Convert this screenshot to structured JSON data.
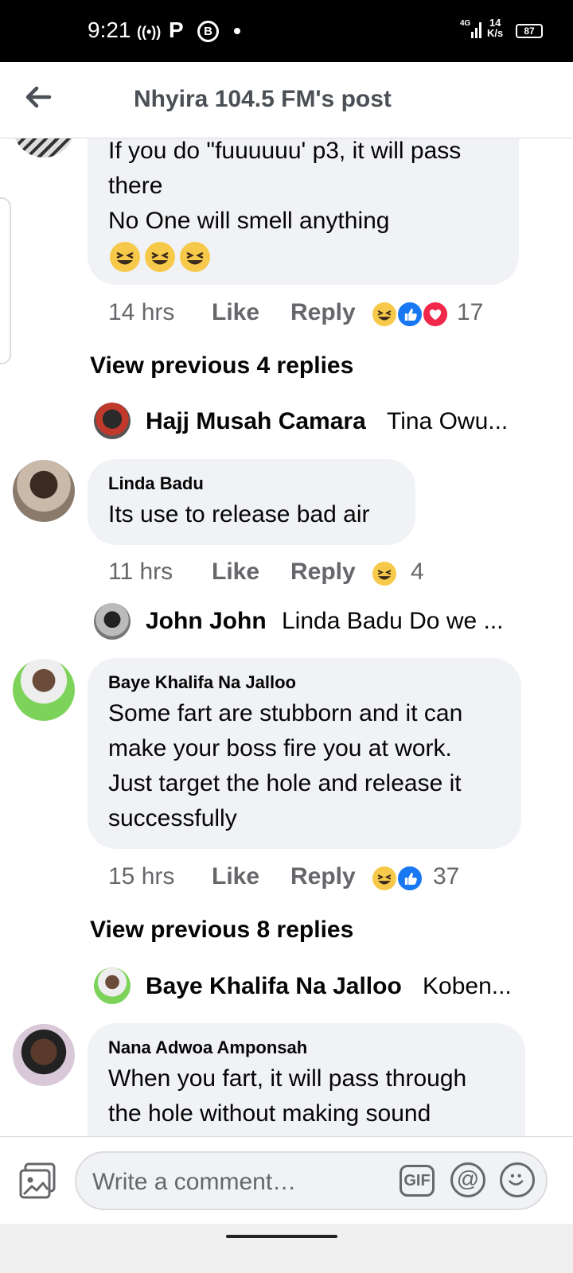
{
  "status_bar": {
    "time": "9:21",
    "net_speed_top": "14",
    "net_speed_bottom": "K/s",
    "network": "4G",
    "battery": "87"
  },
  "header": {
    "title": "Nhyira 104.5 FM's post"
  },
  "comments": [
    {
      "lines": [
        "If you do \"fuuuuuu' p3, it will pass",
        "there",
        "No One will smell anything"
      ],
      "time": "14 hrs",
      "like": "Like",
      "reply": "Reply",
      "reactions": [
        "haha",
        "like",
        "love"
      ],
      "count": "17"
    },
    {
      "author": "Linda Badu",
      "lines": [
        "Its use to release bad air"
      ],
      "time": "11 hrs",
      "like": "Like",
      "reply": "Reply",
      "reactions": [
        "haha"
      ],
      "count": "4"
    },
    {
      "author": "Baye Khalifa Na Jalloo",
      "lines": [
        "Some fart are stubborn and it can",
        "make your boss fire you at work.",
        "Just target the hole and release it",
        "successfully"
      ],
      "time": "15 hrs",
      "like": "Like",
      "reply": "Reply",
      "reactions": [
        "haha",
        "like"
      ],
      "count": "37"
    },
    {
      "author": "Nana Adwoa Amponsah",
      "lines": [
        "When you fart, it will pass through",
        "the hole without making sound"
      ]
    }
  ],
  "view_previous": [
    "View previous 4 replies",
    "View previous 8 replies"
  ],
  "reply_previews": [
    {
      "name": "Hajj Musah Camara",
      "snippet": "Tina Owu..."
    },
    {
      "name": "John John",
      "snippet": "Linda Badu Do we ..."
    },
    {
      "name": "Baye Khalifa Na Jalloo",
      "snippet": "Koben..."
    }
  ],
  "composer": {
    "placeholder": "Write a comment…",
    "gif": "GIF",
    "at": "@"
  },
  "colors": {
    "bubble": "#f0f2f5",
    "meta": "#65676b",
    "like_blue": "#1877f2",
    "love_red": "#f02849",
    "haha_yellow": "#f7c94a"
  }
}
